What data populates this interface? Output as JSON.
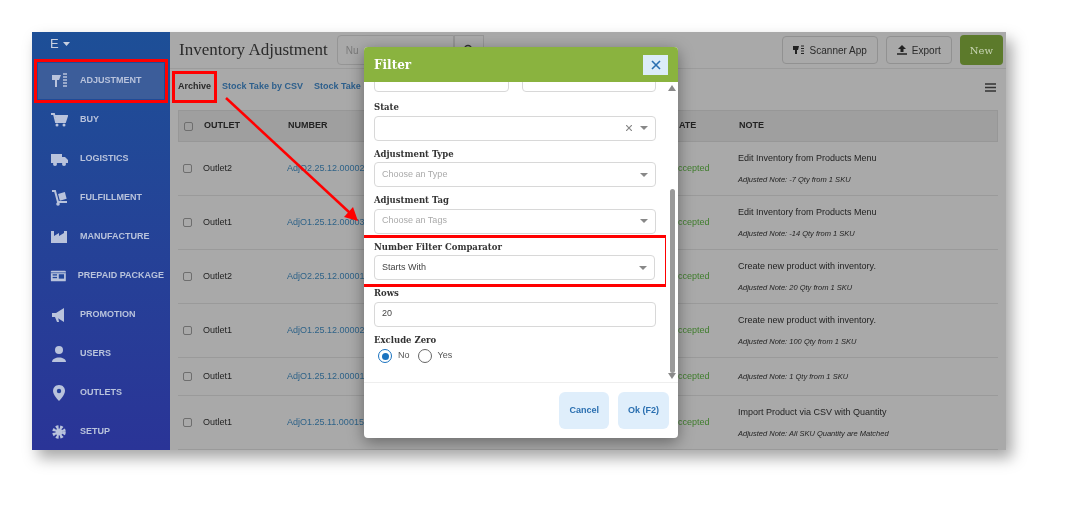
{
  "app_menu": {
    "label": "E"
  },
  "sidebar": {
    "items": [
      {
        "label": "ADJUSTMENT",
        "selected": true,
        "highlighted": true
      },
      {
        "label": "BUY",
        "selected": false,
        "highlighted": false
      },
      {
        "label": "LOGISTICS",
        "selected": false,
        "highlighted": false
      },
      {
        "label": "FULFILLMENT",
        "selected": false,
        "highlighted": false
      },
      {
        "label": "MANUFACTURE",
        "selected": false,
        "highlighted": false
      },
      {
        "label": "PREPAID PACKAGE",
        "selected": false,
        "highlighted": false
      },
      {
        "label": "PROMOTION",
        "selected": false,
        "highlighted": false
      },
      {
        "label": "USERS",
        "selected": false,
        "highlighted": false
      },
      {
        "label": "OUTLETS",
        "selected": false,
        "highlighted": false
      },
      {
        "label": "SETUP",
        "selected": false,
        "highlighted": false
      }
    ]
  },
  "page_title": "Inventory Adjustment",
  "search": {
    "placeholder": "Nu"
  },
  "header_buttons": [
    {
      "label": "Scanner App",
      "kind": "outline"
    },
    {
      "label": "Export",
      "kind": "outline"
    },
    {
      "label": "New",
      "kind": "primary"
    }
  ],
  "tabs": [
    {
      "label": "Archive",
      "selected": true,
      "highlighted": true
    },
    {
      "label": "Stock Take by CSV",
      "selected": false,
      "highlighted": false
    },
    {
      "label": "Stock Take",
      "selected": false,
      "highlighted": false
    }
  ],
  "table": {
    "all_checked": false,
    "columns": [
      "OUTLET",
      "NUMBER",
      "ATE",
      "NOTE"
    ],
    "rows": [
      {
        "checked": false,
        "outlet": "Outlet2",
        "number": "AdjO2.25.12.00002",
        "state": "ccepted",
        "note": "Edit Inventory from Products Menu",
        "adjusted_note": "Adjusted Note: -7 Qty from 1 SKU"
      },
      {
        "checked": false,
        "outlet": "Outlet1",
        "number": "AdjO1.25.12.00003",
        "state": "ccepted",
        "note": "Edit Inventory from Products Menu",
        "adjusted_note": "Adjusted Note: -14 Qty from 1 SKU"
      },
      {
        "checked": false,
        "outlet": "Outlet2",
        "number": "AdjO2.25.12.00001",
        "state": "ccepted",
        "note": "Create new product with inventory.",
        "adjusted_note": "Adjusted Note: 20 Qty from 1 SKU"
      },
      {
        "checked": false,
        "outlet": "Outlet1",
        "number": "AdjO1.25.12.00002",
        "state": "ccepted",
        "note": "Create new product with inventory.",
        "adjusted_note": "Adjusted Note: 100 Qty from 1 SKU"
      },
      {
        "checked": false,
        "outlet": "Outlet1",
        "number": "AdjO1.25.12.00001",
        "state": "ccepted",
        "adjusted_note": "Adjusted Note: 1 Qty from 1 SKU"
      },
      {
        "checked": false,
        "outlet": "Outlet1",
        "number": "AdjO1.25.11.00015",
        "state": "ccepted",
        "note": "Import Product via CSV with Quantity",
        "adjusted_note": "Adjusted Note: All SKU Quantity are Matched"
      }
    ]
  },
  "dialog": {
    "title": "Filter",
    "fields": [
      {
        "kind": "select",
        "label": "State",
        "clearable": true,
        "highlighted": false
      },
      {
        "kind": "select",
        "label": "Adjustment Type",
        "placeholder": "Choose an Type",
        "highlighted": false
      },
      {
        "kind": "select",
        "label": "Adjustment Tag",
        "placeholder": "Choose an Tags",
        "highlighted": false
      },
      {
        "kind": "select",
        "label": "Number Filter Comparator",
        "value": "Starts With",
        "highlighted": true
      },
      {
        "kind": "input",
        "label": "Rows",
        "value": "20",
        "highlighted": false
      },
      {
        "kind": "radio",
        "label": "Exclude Zero",
        "highlighted": false,
        "options": [
          {
            "label": "No",
            "selected": true
          },
          {
            "label": "Yes",
            "selected": false
          }
        ]
      }
    ],
    "buttons": [
      {
        "label": "Cancel"
      },
      {
        "label": "Ok (F2)"
      }
    ]
  }
}
